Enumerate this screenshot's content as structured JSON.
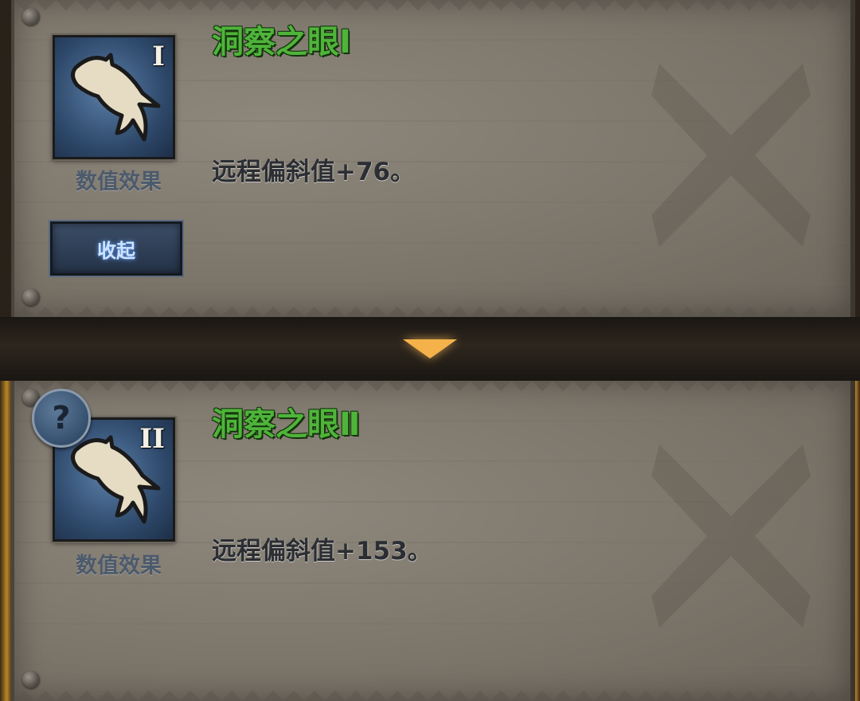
{
  "skills": [
    {
      "title": "洞察之眼Ⅰ",
      "rank": "I",
      "icon_label": "数值效果",
      "icon": "beast-claw-icon",
      "description": "远程偏斜值+76。"
    },
    {
      "title": "洞察之眼Ⅱ",
      "rank": "II",
      "icon_label": "数值效果",
      "icon": "beast-claw-icon",
      "description": "远程偏斜值+153。"
    }
  ],
  "collapse_button": "收起",
  "help_button": "?",
  "colors": {
    "title_green": "#4fb43a",
    "icon_blue": "#2f4a6c",
    "arrow_orange": "#f5b24a"
  }
}
